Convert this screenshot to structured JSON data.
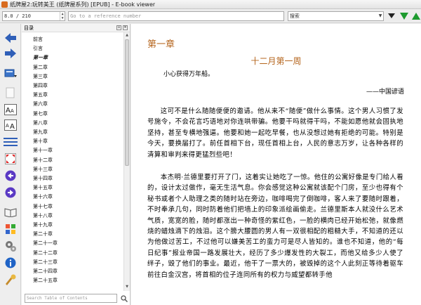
{
  "window": {
    "title": "纸牌屋2:玩转美王 (纸牌屋系列) [EPUB] - E-book viewer"
  },
  "toolbar": {
    "position_value": "8.0 / 210",
    "reference_placeholder": "Go to a reference number",
    "search_value": "搜索"
  },
  "toc": {
    "header": "目录",
    "items": [
      "前言",
      "引言",
      "第一章",
      "第二章",
      "第三章",
      "第四章",
      "第五章",
      "第六章",
      "第七章",
      "第八章",
      "第九章",
      "第十章",
      "第十一章",
      "第十二章",
      "第十三章",
      "第十四章",
      "第十五章",
      "第十六章",
      "第十七章",
      "第十八章",
      "第十九章",
      "第二十章",
      "第二十一章",
      "第二十二章",
      "第二十三章",
      "第二十四章",
      "第二十五章"
    ],
    "current_index": 2,
    "search_placeholder": "Search Table of Contents"
  },
  "content": {
    "chapter_title": "第一章",
    "section_title": "十二月第一周",
    "epigraph": "小心获得万年船。",
    "epigraph_source": "——中国谚语",
    "paragraph1": "这可不是什么随随便便的邀请。他从来不“随便”做什么事情。这个男人习惯了发号施令，不会花言巧语地对你连哄带骗。他要干吗就得干吗，不能如愿他就会固执地坚持，甚至专横地强逼。他要和她一起吃早餐，也从没想过她有拒绝的可能。特别是今天，要换届打了。前任首相下台，现任首相上台，人民的意志万岁，让各种各样的清算和审判来得更猛烈些吧！",
    "paragraph2": "本杰明·兰德里要打开了门，这着实让她吃了一惊。他住的公寓好像是专门给人看的，设计太过做作，毫无生活气息。你会感觉这种公寓就该配个门房，至少也得有个秘书或者个人助理之类的随时站在旁边，咖啡喝完了倒咖啡，客人来了要随时跟着，不时奉承几句，同时防着他们把墙上的印象派绘画偷走。兰德里斯本人就没什么艺术气质，宽宽的脸，随时都涨出一种奇怪的紫红色，一脸的横肉已经开始松弛，就像燃烧的蜡烛滴下的烛泪。这个膀大腰圆的男人有一双很相配的粗糙大手，不知道的还以为他做过苦工，不过他可以嫌美苦工的蛮力可是尽人皆知的。谁也不知道，他的“每日纪事”报业帝国一路发展壮大，经历了多少爆发性的大裂工，而他又给多少人使了绊子，毁了他们的事业。最近，他干了一票大的，被毁掉的这个人此刻正等待着驱车前往白金汉宫，将首相的位子连同所有的权力与威望都转手他"
  },
  "colors": {
    "heading": "#b5651d",
    "accent_blue": "#2f5fb8",
    "accent_green": "#1d9a2e"
  },
  "icons": {
    "left_toolbar": [
      "back-arrow-icon",
      "forward-arrow-icon",
      "open-book-icon",
      "copy-icon",
      "font-larger-icon",
      "font-smaller-icon",
      "toc-list-icon",
      "fullscreen-icon",
      "previous-page-icon",
      "next-page-icon",
      "library-icon",
      "preferences-icon",
      "settings-icon",
      "info-icon",
      "tools-icon"
    ]
  }
}
